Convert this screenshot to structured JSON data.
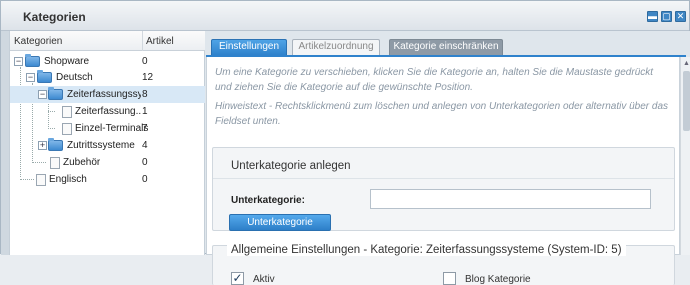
{
  "window": {
    "title": "Kategorien",
    "buttons": {
      "minimize": "▬",
      "maximize": "▢",
      "close": "✕"
    }
  },
  "tree": {
    "headers": {
      "name": "Kategorien",
      "count": "Artikel"
    },
    "rows": [
      {
        "label": "Shopware",
        "count": "0"
      },
      {
        "label": "Deutsch",
        "count": "12"
      },
      {
        "label": "Zeiterfassungssy...",
        "count": "8"
      },
      {
        "label": "Zeiterfassung...",
        "count": "1"
      },
      {
        "label": "Einzel-Terminals",
        "count": "7"
      },
      {
        "label": "Zutrittssysteme",
        "count": "4"
      },
      {
        "label": "Zubehör",
        "count": "0"
      },
      {
        "label": "Englisch",
        "count": "0"
      }
    ],
    "toggles": {
      "minus": "−",
      "plus": "+"
    }
  },
  "tabs": [
    {
      "label": "Einstellungen"
    },
    {
      "label": "Artikelzuordnung"
    },
    {
      "label": "Kategorie einschränken"
    }
  ],
  "info": {
    "line1": "Um eine Kategorie zu verschieben, klicken Sie die Kategorie an, halten Sie die Maustaste gedrückt und ziehen Sie die Kategorie auf die gewünschte Position.",
    "line2": "Hinweistext - Rechtsklickmenü zum löschen und anlegen von Unterkategorien oder alternativ über das Fieldset unten."
  },
  "subcategory": {
    "legend": "Unterkategorie anlegen",
    "field_label": "Unterkategorie:",
    "field_value": "",
    "button": "Unterkategorie anlegen"
  },
  "general": {
    "legend": "Allgemeine Einstellungen - Kategorie: Zeiterfassungssysteme (System-ID: 5)",
    "active_label": "Aktiv",
    "active_checked": "✓",
    "blog_label": "Blog Kategorie"
  }
}
